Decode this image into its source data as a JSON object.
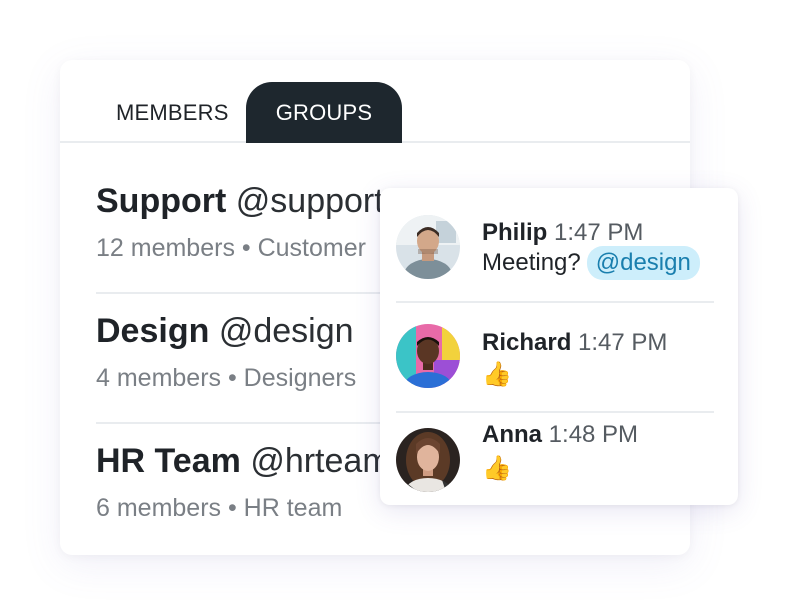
{
  "tabs": {
    "members": "MEMBERS",
    "groups": "GROUPS"
  },
  "groups": [
    {
      "name": "Support",
      "handle": "@support",
      "meta": "12 members • Customer"
    },
    {
      "name": "Design",
      "handle": "@design",
      "meta": "4 members • Designers"
    },
    {
      "name": "HR Team",
      "handle": "@hrteam",
      "meta": "6 members • HR team"
    }
  ],
  "messages": [
    {
      "name": "Philip",
      "time": "1:47 PM",
      "text": "Meeting?",
      "mention": "@design",
      "avatar": "man-portrait"
    },
    {
      "name": "Richard",
      "time": "1:47 PM",
      "text": "👍",
      "avatar": "man-portrait-colorful"
    },
    {
      "name": "Anna",
      "time": "1:48 PM",
      "text": "👍",
      "avatar": "woman-portrait"
    }
  ],
  "colors": {
    "tab_active_bg": "#1e272e",
    "mention_bg": "#cdeefb",
    "mention_text": "#1a7fae"
  }
}
